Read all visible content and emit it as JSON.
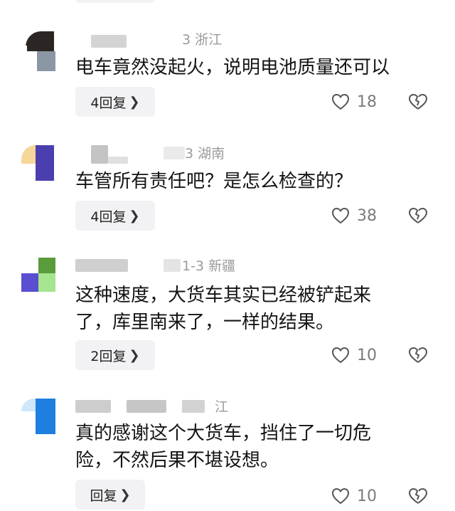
{
  "comments": [
    {
      "meta_text": "3  浙江",
      "body": "电车竟然没起火，说明电池质量还可以",
      "reply_label": "4回复",
      "like_count": "18",
      "avatar_colors": [
        "#2b2623",
        "#8b97a4",
        "#ffffff"
      ]
    },
    {
      "meta_text": "3  湖南",
      "body": "车管所有责任吧？是怎么检查的？",
      "reply_label": "4回复",
      "like_count": "38",
      "avatar_colors": [
        "#4b3fb0",
        "#f5d79a",
        "#c9cbe8"
      ]
    },
    {
      "meta_text": "1-3  新疆",
      "body": "这种速度，大货车其实已经被铲起来\n了，库里南来了，一样的结果。",
      "reply_label": "2回复",
      "like_count": "10",
      "avatar_colors": [
        "#5a9b3c",
        "#5a4fd0",
        "#a5e58f"
      ]
    },
    {
      "meta_text": "江",
      "body": "真的感谢这个大货车，挡住了一切危\n险，不然后果不堪设想。",
      "reply_label": "回复",
      "like_count": "10",
      "avatar_colors": [
        "#1e7fe0",
        "#4aa8f5",
        "#cfe6fb"
      ]
    }
  ],
  "colors": {
    "meta": "#9a9a9a",
    "body": "#141414",
    "like_count": "#7b7b7b",
    "reply_bg": "#f2f2f4"
  },
  "icons": {
    "reply_chevron": "chevron-right-icon",
    "like": "heart-icon",
    "dislike": "broken-heart-icon"
  }
}
